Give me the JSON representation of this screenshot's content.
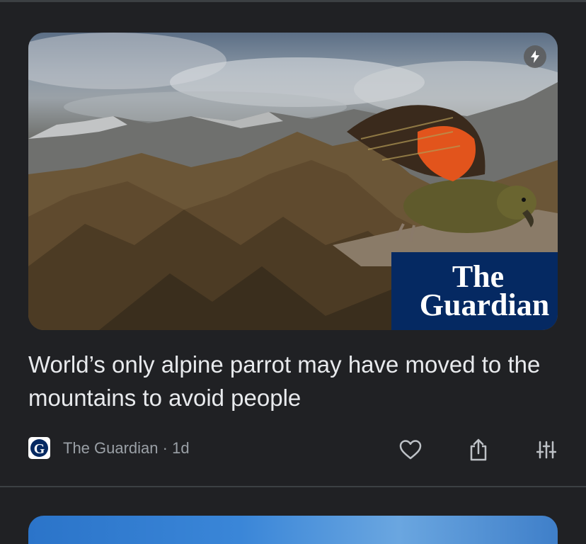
{
  "article": {
    "headline": "World’s only alpine parrot may have moved to the mountains to avoid people",
    "image": {
      "alt": "Kea parrot flying over alpine mountains",
      "amp_icon": "lightning-icon",
      "overlay_logo": {
        "line1": "The",
        "line2": "Guardian"
      }
    },
    "source": {
      "name": "The Guardian",
      "age": "1d",
      "logo_letter": "G"
    },
    "actions": [
      {
        "name": "like",
        "icon": "heart-icon"
      },
      {
        "name": "share",
        "icon": "share-icon"
      },
      {
        "name": "more",
        "icon": "tune-icon"
      }
    ]
  },
  "colors": {
    "background": "#202124",
    "text": "#e8eaed",
    "secondary_text": "#9aa0a6",
    "guardian_blue": "#052962"
  }
}
